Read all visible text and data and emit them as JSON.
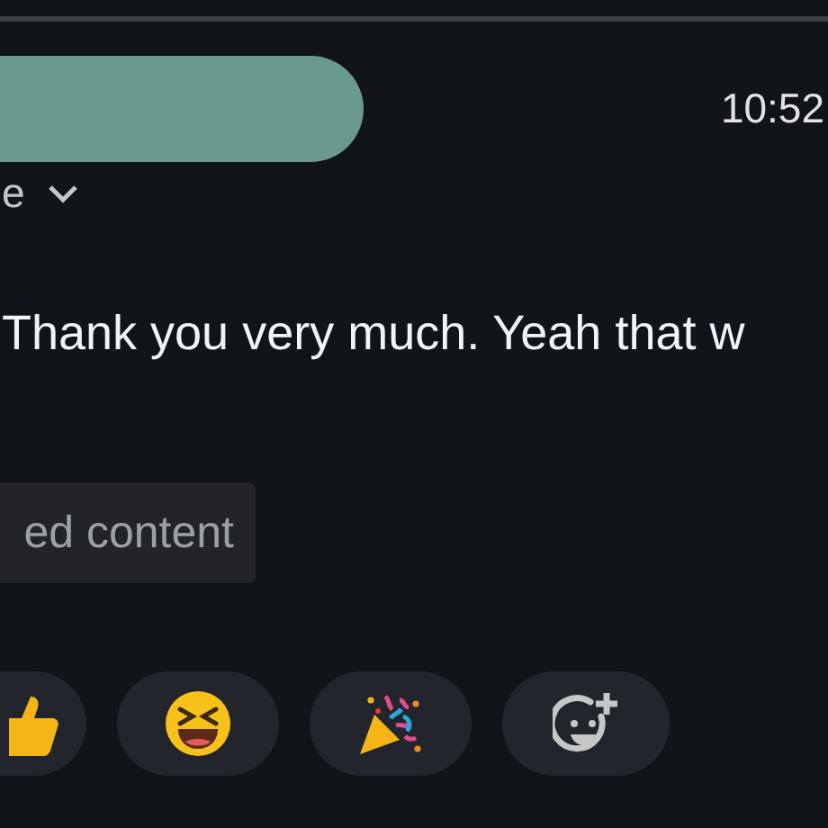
{
  "header": {
    "time": "10:52",
    "recipient": "e"
  },
  "message": {
    "body": "Thank you very much. Yeah that w"
  },
  "trimmed_button": {
    "label": "ed content"
  },
  "reactions": [
    {
      "kind": "thumbsup"
    },
    {
      "kind": "laugh"
    },
    {
      "kind": "party"
    },
    {
      "kind": "add"
    }
  ]
}
